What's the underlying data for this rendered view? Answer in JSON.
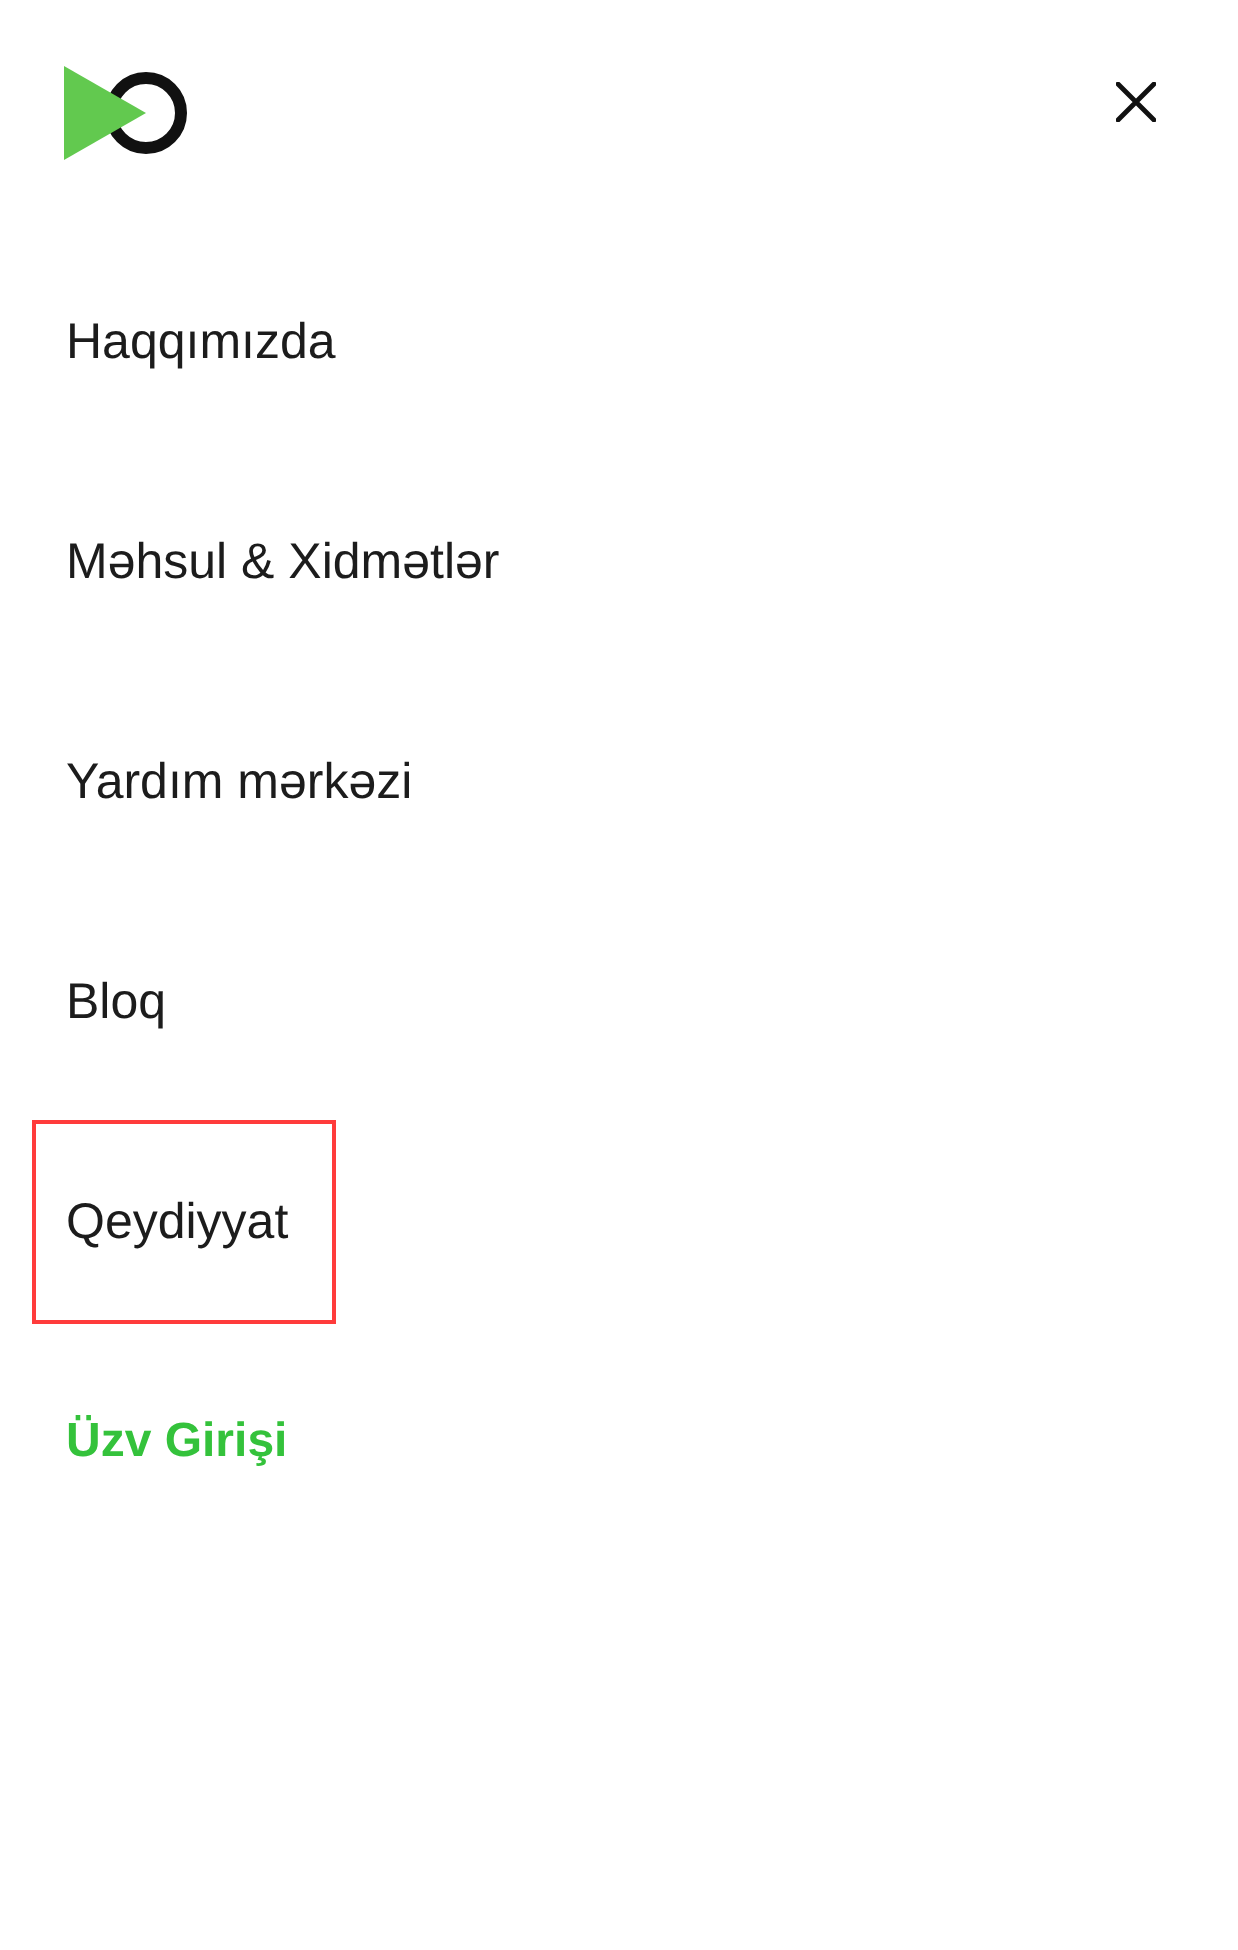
{
  "menu": {
    "items": [
      {
        "label": "Haqqımızda",
        "kind": "link",
        "highlighted": false
      },
      {
        "label": "Məhsul & Xidmətlər",
        "kind": "link",
        "highlighted": false
      },
      {
        "label": "Yardım mərkəzi",
        "kind": "link",
        "highlighted": false
      },
      {
        "label": "Bloq",
        "kind": "link",
        "highlighted": false
      },
      {
        "label": "Qeydiyyat",
        "kind": "link",
        "highlighted": true
      },
      {
        "label": "Üzv Girişi",
        "kind": "accent",
        "highlighted": false
      }
    ]
  }
}
